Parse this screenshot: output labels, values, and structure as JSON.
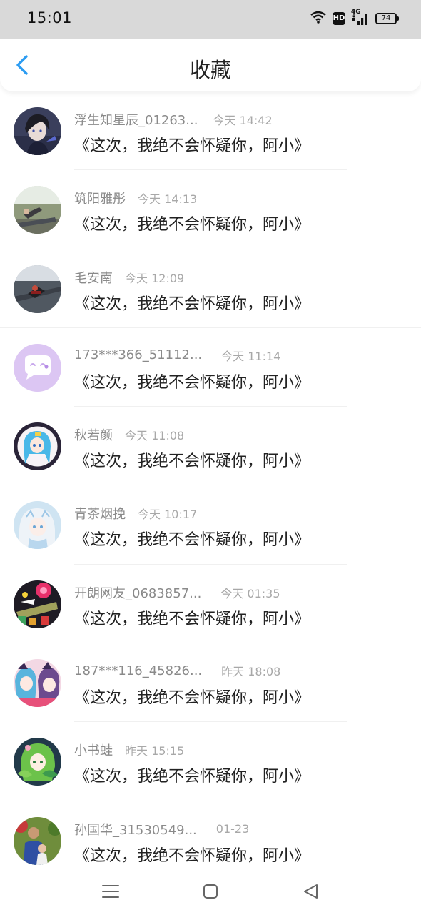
{
  "status_bar": {
    "time": "15:01",
    "network": "4G",
    "hd": "HD",
    "battery": "74",
    "icons": [
      "wifi-icon",
      "hd-icon",
      "signal-4g-icon",
      "battery-icon"
    ]
  },
  "header": {
    "title": "收藏",
    "back_icon": "chevron-left-icon",
    "accent_color": "#2b9cf2"
  },
  "items": [
    {
      "name": "浮生知星辰_01263...",
      "time": "今天 14:42",
      "message": "《这次，我绝不会怀疑你，阿小》",
      "avatar": "avatar-dark-hair-boy"
    },
    {
      "name": "筑阳雅彤",
      "time": "今天 14:13",
      "message": "《这次，我绝不会怀疑你，阿小》",
      "avatar": "avatar-outdoor-photo"
    },
    {
      "name": "毛安南",
      "time": "今天 12:09",
      "message": "《这次，我绝不会怀疑你，阿小》",
      "avatar": "avatar-road-illustration"
    },
    {
      "name": "173***366_51112...",
      "time": "今天 11:14",
      "message": "《这次，我绝不会怀疑你，阿小》",
      "avatar": "avatar-default-chat"
    },
    {
      "name": "秋若颜",
      "time": "今天 11:08",
      "message": "《这次，我绝不会怀疑你，阿小》",
      "avatar": "avatar-anime-blue-hair"
    },
    {
      "name": "青茶烟挽",
      "time": "今天 10:17",
      "message": "《这次，我绝不会怀疑你，阿小》",
      "avatar": "avatar-anime-white-hair"
    },
    {
      "name": "开朗网友_0683857...",
      "time": "今天 01:35",
      "message": "《这次，我绝不会怀疑你，阿小》",
      "avatar": "avatar-colorful-art"
    },
    {
      "name": "187***116_45826...",
      "time": "昨天 18:08",
      "message": "《这次，我绝不会怀疑你，阿小》",
      "avatar": "avatar-anime-pair"
    },
    {
      "name": "小书蛙",
      "time": "昨天 15:15",
      "message": "《这次，我绝不会怀疑你，阿小》",
      "avatar": "avatar-anime-green-hair"
    },
    {
      "name": "孙国华_31530549...",
      "time": "01-23",
      "message": "《这次，我绝不会怀疑你，阿小》",
      "avatar": "avatar-family-photo"
    }
  ],
  "nav_bar": {
    "icons": [
      "menu-icon",
      "home-square-icon",
      "back-triangle-icon"
    ]
  }
}
